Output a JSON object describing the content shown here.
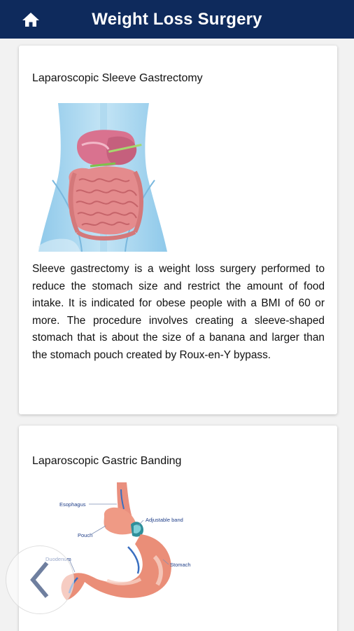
{
  "app_bar": {
    "title": "Weight Loss Surgery",
    "home_icon": "home-icon"
  },
  "cards": [
    {
      "title": "Laparoscopic Sleeve Gastrectomy",
      "image": "abdomen-anatomy-illustration",
      "description": "Sleeve gastrectomy is a weight loss surgery performed to reduce the stomach size and restrict the amount of food intake. It is indicated for obese people with a BMI of 60 or more. The procedure involves creating a sleeve-shaped stomach that is about the size of a banana and larger than the stomach pouch created by Roux-en-Y bypass."
    },
    {
      "title": "Laparoscopic Gastric Banding",
      "image": "gastric-band-illustration",
      "labels": {
        "esophagus": "Esophagus",
        "adjustable_band": "Adjustable band",
        "pouch": "Pouch",
        "duodenum": "Duodenum",
        "stomach": "Stomach"
      }
    }
  ],
  "nav": {
    "back_icon": "chevron-left-icon"
  },
  "colors": {
    "app_bar": "#0e2a5c",
    "background": "#f2f2f2",
    "card": "#ffffff"
  }
}
